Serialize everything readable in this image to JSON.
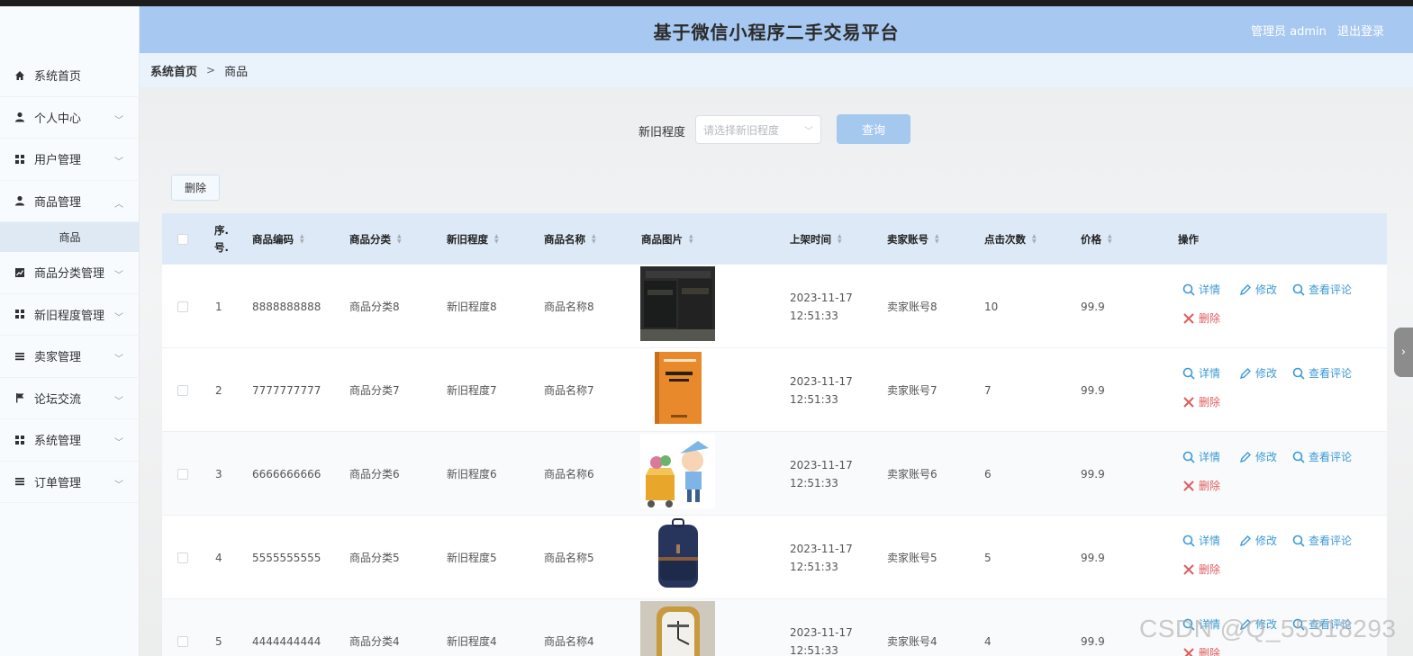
{
  "header": {
    "title": "基于微信小程序二手交易平台",
    "user_label": "管理员 admin",
    "logout_label": "退出登录"
  },
  "sidebar": {
    "items": [
      {
        "label": "系统首页",
        "icon": "home-icon"
      },
      {
        "label": "个人中心",
        "icon": "user-icon"
      },
      {
        "label": "用户管理",
        "icon": "grid-icon"
      },
      {
        "label": "商品管理",
        "icon": "user-icon",
        "sub": [
          "商品"
        ]
      },
      {
        "label": "商品分类管理",
        "icon": "chart-icon"
      },
      {
        "label": "新旧程度管理",
        "icon": "grid-icon"
      },
      {
        "label": "卖家管理",
        "icon": "list-icon"
      },
      {
        "label": "论坛交流",
        "icon": "flag-icon"
      },
      {
        "label": "系统管理",
        "icon": "grid-icon"
      },
      {
        "label": "订单管理",
        "icon": "list-icon"
      }
    ]
  },
  "breadcrumb": {
    "home": "系统首页",
    "separator": ">",
    "current": "商品"
  },
  "search": {
    "label": "新旧程度",
    "placeholder": "请选择新旧程度",
    "button": "查询"
  },
  "toolbar": {
    "delete_label": "删除"
  },
  "table": {
    "headers": [
      "序号",
      "商品编码",
      "商品分类",
      "新旧程度",
      "商品名称",
      "商品图片",
      "上架时间",
      "卖家账号",
      "点击次数",
      "价格",
      "操作"
    ],
    "index_header_lines": [
      "序.",
      "号."
    ],
    "rows": [
      {
        "index": "1",
        "code": "8888888888",
        "category": "商品分类8",
        "condition": "新旧程度8",
        "name": "商品名称8",
        "date": "2023-11-17",
        "time": "12:51:33",
        "seller": "卖家账号8",
        "clicks": "10",
        "price": "99.9",
        "image": "black-boxes"
      },
      {
        "index": "2",
        "code": "7777777777",
        "category": "商品分类7",
        "condition": "新旧程度7",
        "name": "商品名称7",
        "date": "2023-11-17",
        "time": "12:51:33",
        "seller": "卖家账号7",
        "clicks": "7",
        "price": "99.9",
        "image": "orange-book"
      },
      {
        "index": "3",
        "code": "6666666666",
        "category": "商品分类6",
        "condition": "新旧程度6",
        "name": "商品名称6",
        "date": "2023-11-17",
        "time": "12:51:33",
        "seller": "卖家账号6",
        "clicks": "6",
        "price": "99.9",
        "image": "cartoon-boy"
      },
      {
        "index": "4",
        "code": "5555555555",
        "category": "商品分类5",
        "condition": "新旧程度5",
        "name": "商品名称5",
        "date": "2023-11-17",
        "time": "12:51:33",
        "seller": "卖家账号5",
        "clicks": "5",
        "price": "99.9",
        "image": "backpack"
      },
      {
        "index": "5",
        "code": "4444444444",
        "category": "商品分类4",
        "condition": "新旧程度4",
        "name": "商品名称4",
        "date": "2023-11-17",
        "time": "12:51:33",
        "seller": "卖家账号4",
        "clicks": "4",
        "price": "99.9",
        "image": "gold-watch"
      }
    ],
    "actions": {
      "detail": "详情",
      "edit": "修改",
      "comments": "查看评论",
      "delete": "删除"
    }
  },
  "watermark": "CSDN @Q_55318293",
  "colors": {
    "header_bg": "#a7c8f0",
    "table_head_bg": "#dde9f7",
    "link": "#3c9ad6",
    "danger": "#e05c5c",
    "button_bg": "#a4c8ee"
  }
}
